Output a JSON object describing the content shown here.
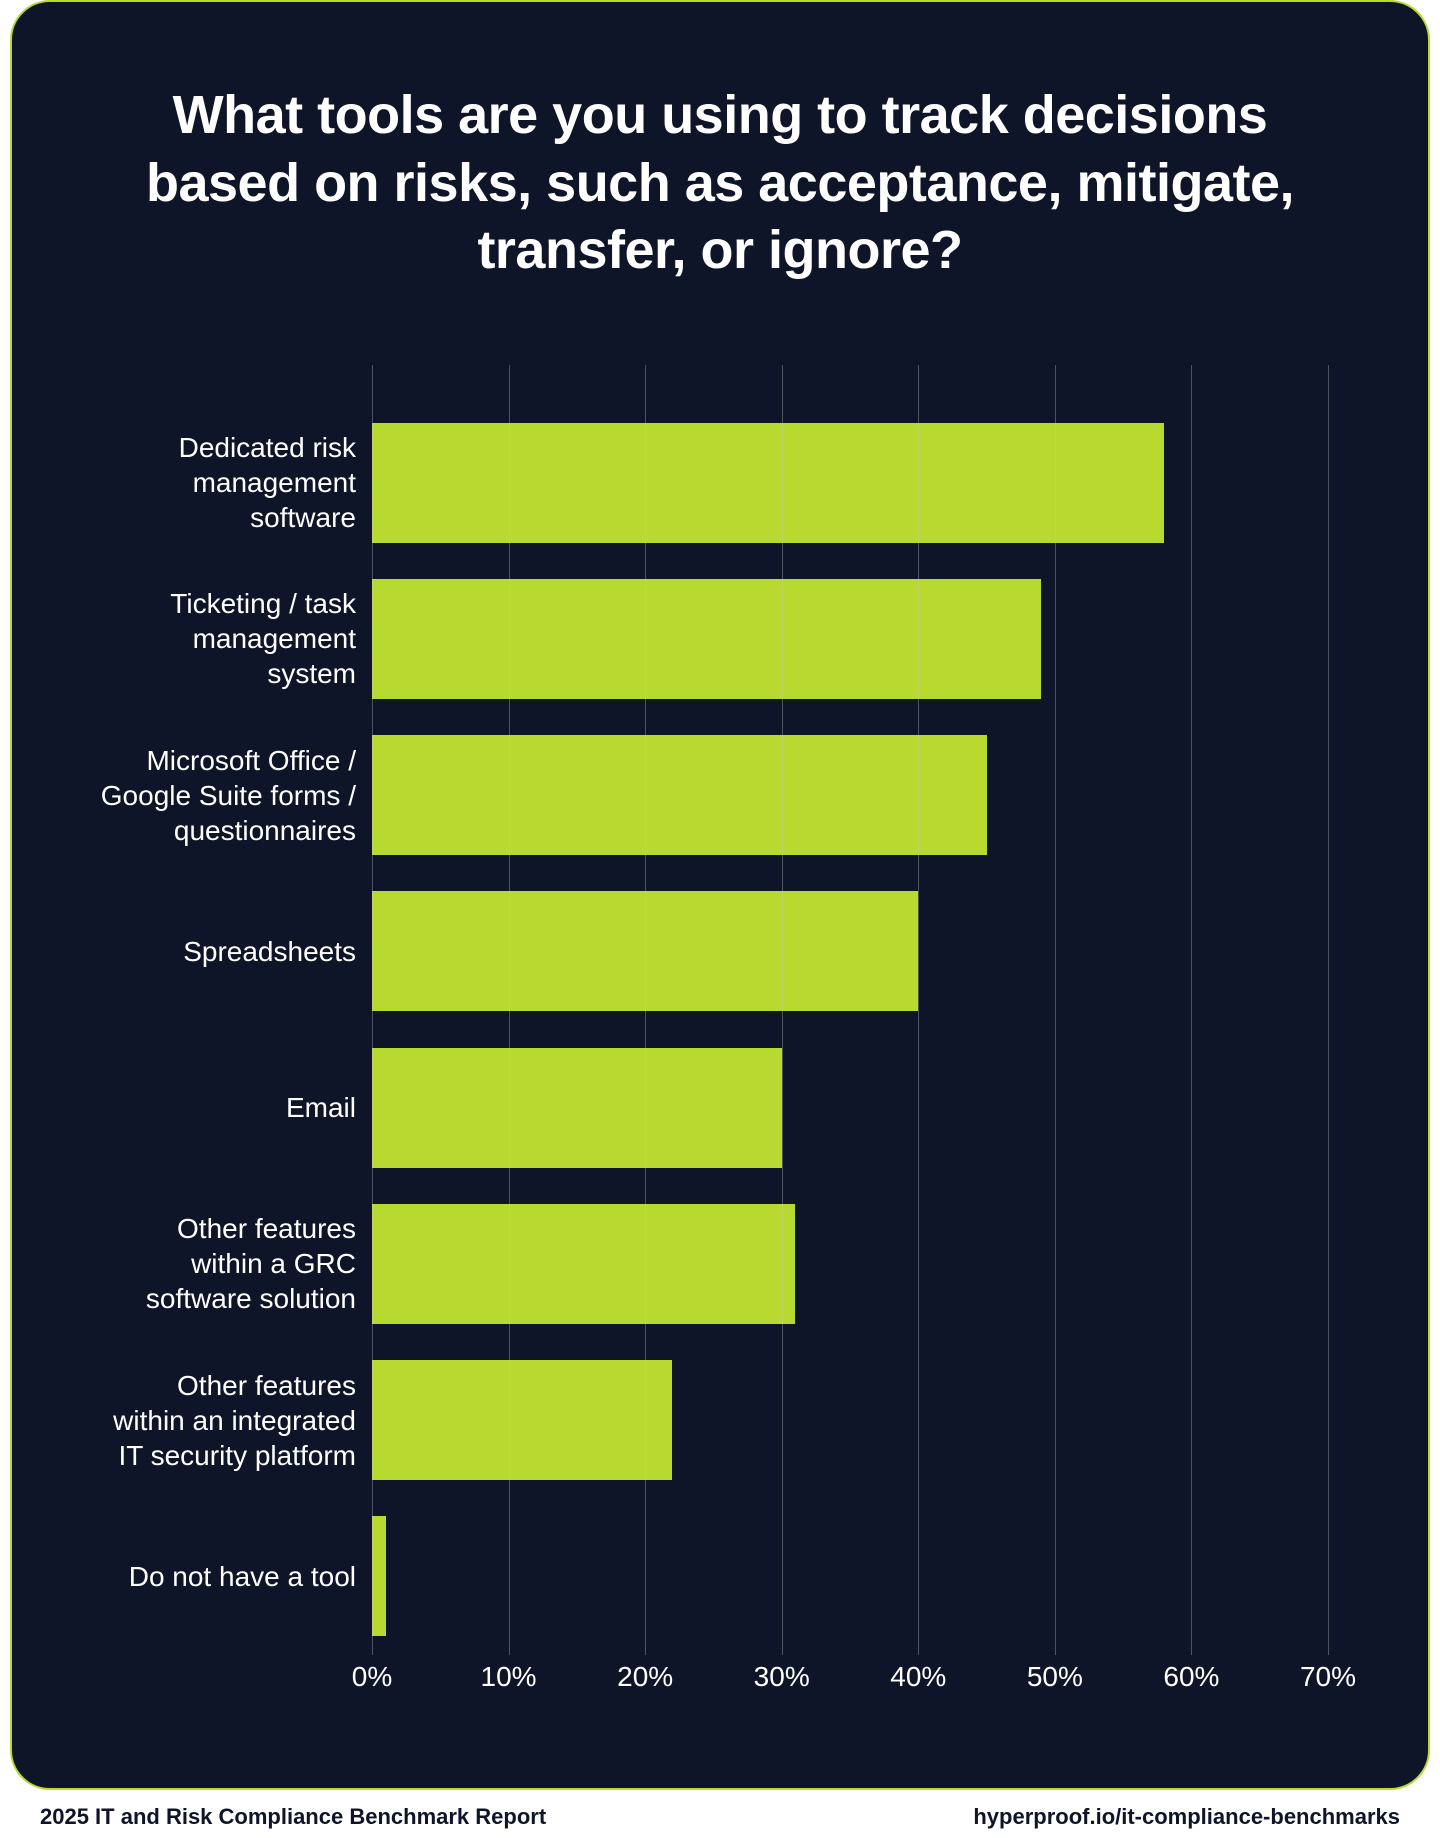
{
  "title": "What tools are you using to track decisions based on risks, such as acceptance, mitigate, transfer, or ignore?",
  "footer_left": "2025 IT and Risk Compliance Benchmark Report",
  "footer_right": "hyperproof.io/it-compliance-benchmarks",
  "chart_data": {
    "type": "bar",
    "orientation": "horizontal",
    "categories": [
      "Dedicated risk\nmanagement\nsoftware",
      "Ticketing / task\nmanagement\nsystem",
      "Microsoft Office /\nGoogle Suite forms /\nquestionnaires",
      "Spreadsheets",
      "Email",
      "Other features\nwithin a GRC\nsoftware solution",
      "Other features\nwithin an integrated\nIT security platform",
      "Do not have a tool"
    ],
    "values": [
      58,
      49,
      45,
      40,
      30,
      31,
      22,
      1
    ],
    "xlabel": "",
    "ylabel": "",
    "xlim": [
      0,
      70
    ],
    "x_ticks": [
      0,
      10,
      20,
      30,
      40,
      50,
      60,
      70
    ],
    "x_tick_labels": [
      "0%",
      "10%",
      "20%",
      "30%",
      "40%",
      "50%",
      "60%",
      "70%"
    ],
    "bar_color": "#b8d92f",
    "background": "#0f1528"
  }
}
